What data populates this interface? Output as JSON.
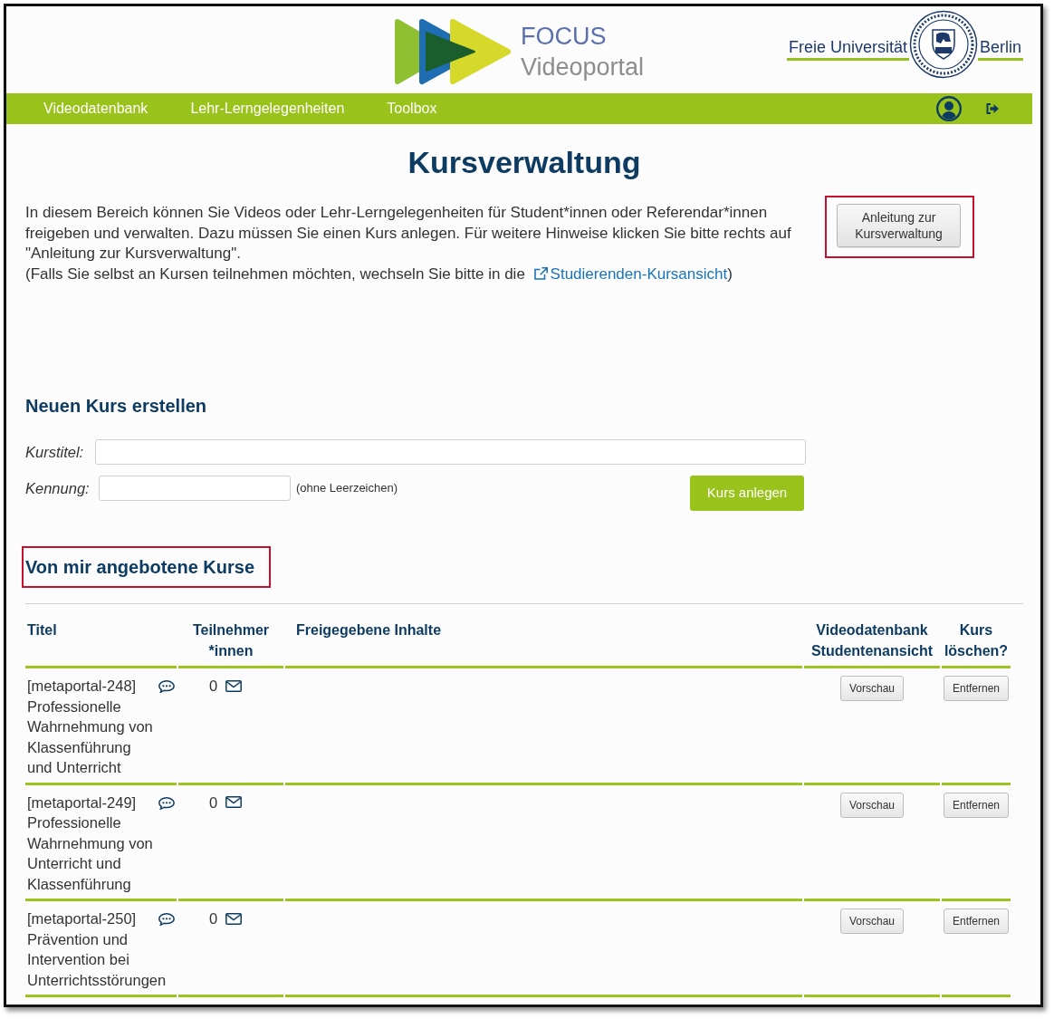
{
  "header": {
    "logo": {
      "line_1": "FOCUS",
      "line_2": "Videoportal"
    },
    "university": {
      "name_left": "Freie Universität",
      "name_right": "Berlin"
    }
  },
  "nav": {
    "items": [
      {
        "label": "Videodatenbank"
      },
      {
        "label": "Lehr-Lerngelegenheiten"
      },
      {
        "label": "Toolbox"
      }
    ]
  },
  "intro": {
    "title": "Kursverwaltung",
    "text": "In diesem Bereich können Sie Videos oder Lehr-Lerngelegenheiten für Student*innen oder Referendar*innen freigeben und verwalten. Dazu müssen Sie einen Kurs anlegen. Für weitere Hinweise klicken Sie bitte rechts auf \"Anleitung zur Kursverwaltung\".",
    "note": {
      "before": "(Falls Sie selbst an Kursen teilnehmen möchten, wechseln Sie bitte in die",
      "link": "Studierenden-Kursansicht",
      "after": ")"
    },
    "guide_button": {
      "label": "Anleitung zur Kursverwaltung",
      "highlighted": true
    }
  },
  "new_course": {
    "heading": "Neuen Kurs erstellen",
    "fields": [
      {
        "label": "Kurstitel:"
      },
      {
        "label": "Kennung:",
        "hint": "(ohne Leerzeichen)"
      }
    ],
    "submit_button": "Kurs anlegen"
  },
  "courses": {
    "heading": "Von mir angebotene Kurse",
    "highlighted": true,
    "columns": [
      "Titel",
      "Teilnehmer *innen",
      "Freigegebene Inhalte",
      "Videodatenbank Studentenansicht",
      "Kurs löschen?"
    ],
    "rows": [
      {
        "title": "[metaportal-248] Professionelle Wahrnehmung von Klassenführung und Unterricht",
        "participants": "0",
        "preview_button": "Vorschau",
        "remove_button": "Entfernen"
      },
      {
        "title": "[metaportal-249] Professionelle Wahrnehmung von Unterricht und Klassenführung",
        "participants": "0",
        "preview_button": "Vorschau",
        "remove_button": "Entfernen"
      },
      {
        "title": "[metaportal-250] Prävention und Intervention bei Unterrichtsstörungen",
        "participants": "0",
        "preview_button": "Vorschau",
        "remove_button": "Entfernen"
      }
    ]
  }
}
